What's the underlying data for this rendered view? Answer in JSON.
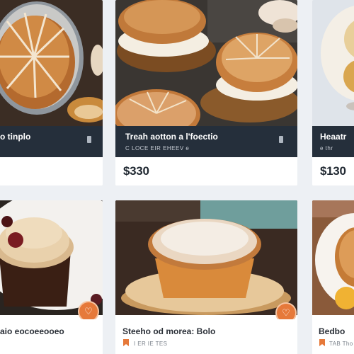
{
  "colors": {
    "page_bg": "#edf0f4",
    "band_bg": "#252f3b",
    "accent": "#e6793a"
  },
  "top_row": [
    {
      "title": "o tinplo",
      "subtitle": "",
      "price": ""
    },
    {
      "title": "Treah aotton a l'foectio",
      "subtitle": "C LOCE EIR  EHEEV e",
      "price": "$330"
    },
    {
      "title": "Heaatr",
      "subtitle": "e thr",
      "price": "$130"
    }
  ],
  "bottom_row": [
    {
      "title": "aio  eocoeeooeo",
      "subtitle": "",
      "fav_icon": "heart-icon"
    },
    {
      "title": "Steeho od morea: Bolo",
      "subtitle": "I ER  IE TES",
      "fav_icon": "heart-icon"
    },
    {
      "title": "Bedbo",
      "subtitle": "TAB  Tho",
      "fav_icon": "heart-icon"
    }
  ]
}
